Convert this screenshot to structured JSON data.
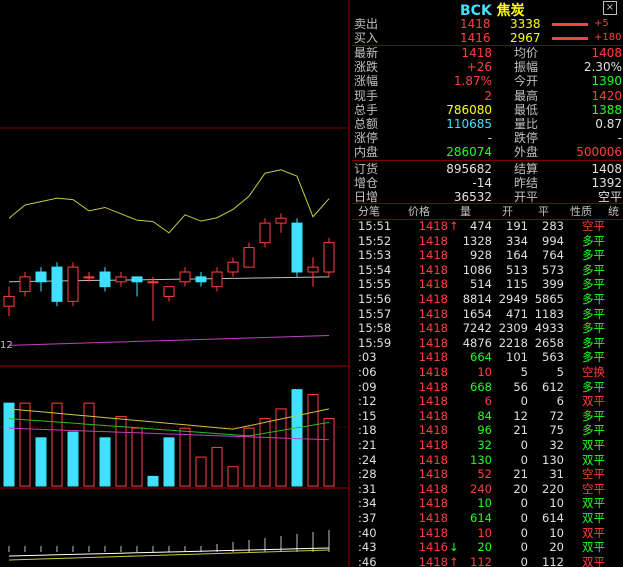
{
  "header": {
    "code": "BCK",
    "name": "焦炭",
    "close_glyph": "×"
  },
  "order_book": [
    {
      "label": "卖出",
      "price": "1418",
      "volume": "3338",
      "delta": "+5"
    },
    {
      "label": "买入",
      "price": "1416",
      "volume": "2967",
      "delta": "+180"
    }
  ],
  "quote": [
    {
      "l1": "最新",
      "v1": "1418",
      "c1": "red",
      "l2": "均价",
      "v2": "1408",
      "c2": "red"
    },
    {
      "l1": "涨跌",
      "v1": "+26",
      "c1": "red",
      "l2": "振幅",
      "v2": "2.30%",
      "c2": "white"
    },
    {
      "l1": "涨幅",
      "v1": "1.87%",
      "c1": "red",
      "l2": "今开",
      "v2": "1390",
      "c2": "green"
    },
    {
      "l1": "现手",
      "v1": "2",
      "c1": "red",
      "l2": "最高",
      "v2": "1420",
      "c2": "red"
    },
    {
      "l1": "总手",
      "v1": "786080",
      "c1": "yellow",
      "l2": "最低",
      "v2": "1388",
      "c2": "green"
    },
    {
      "l1": "总额",
      "v1": "110685",
      "c1": "cyan",
      "l2": "量比",
      "v2": "0.87",
      "c2": "white"
    },
    {
      "l1": "涨停",
      "v1": "-",
      "c1": "white",
      "l2": "跌停",
      "v2": "-",
      "c2": "white"
    },
    {
      "l1": "内盘",
      "v1": "286074",
      "c1": "green",
      "l2": "外盘",
      "v2": "500006",
      "c2": "red"
    }
  ],
  "stats": [
    {
      "l1": "订货",
      "v1": "895682",
      "l2": "结算",
      "v2": "1408"
    },
    {
      "l1": "增仓",
      "v1": "-14",
      "l2": "昨结",
      "v2": "1392"
    },
    {
      "l1": "日增",
      "v1": "36532",
      "l2": "开平",
      "v2": "空平"
    }
  ],
  "tick_headers": [
    "分笔",
    "价格",
    "量",
    "开",
    "平",
    "性质",
    "统"
  ],
  "ticks": [
    {
      "t": "15:51",
      "p": "1418",
      "a": "up",
      "v": "474",
      "o": "191",
      "c": "283",
      "n": "空平",
      "nc": "red"
    },
    {
      "t": "15:52",
      "p": "1418",
      "a": "",
      "v": "1328",
      "o": "334",
      "c": "994",
      "n": "多平",
      "nc": "green"
    },
    {
      "t": "15:53",
      "p": "1418",
      "a": "",
      "v": "928",
      "o": "164",
      "c": "764",
      "n": "多平",
      "nc": "green"
    },
    {
      "t": "15:54",
      "p": "1418",
      "a": "",
      "v": "1086",
      "o": "513",
      "c": "573",
      "n": "多平",
      "nc": "green"
    },
    {
      "t": "15:55",
      "p": "1418",
      "a": "",
      "v": "514",
      "o": "115",
      "c": "399",
      "n": "多平",
      "nc": "green"
    },
    {
      "t": "15:56",
      "p": "1418",
      "a": "",
      "v": "8814",
      "o": "2949",
      "c": "5865",
      "n": "多平",
      "nc": "green"
    },
    {
      "t": "15:57",
      "p": "1418",
      "a": "",
      "v": "1654",
      "o": "471",
      "c": "1183",
      "n": "多平",
      "nc": "green"
    },
    {
      "t": "15:58",
      "p": "1418",
      "a": "",
      "v": "7242",
      "o": "2309",
      "c": "4933",
      "n": "多平",
      "nc": "green"
    },
    {
      "t": "15:59",
      "p": "1418",
      "a": "",
      "v": "4876",
      "o": "2218",
      "c": "2658",
      "n": "多平",
      "nc": "green"
    },
    {
      "t": ":03",
      "p": "1418",
      "a": "",
      "v": "664",
      "o": "101",
      "c": "563",
      "n": "多平",
      "nc": "green"
    },
    {
      "t": ":06",
      "p": "1418",
      "a": "",
      "v": "10",
      "o": "5",
      "c": "5",
      "n": "空换",
      "nc": "red"
    },
    {
      "t": ":09",
      "p": "1418",
      "a": "",
      "v": "668",
      "o": "56",
      "c": "612",
      "n": "多平",
      "nc": "green"
    },
    {
      "t": ":12",
      "p": "1418",
      "a": "",
      "v": "6",
      "o": "0",
      "c": "6",
      "n": "双平",
      "nc": "red"
    },
    {
      "t": ":15",
      "p": "1418",
      "a": "",
      "v": "84",
      "o": "12",
      "c": "72",
      "n": "多平",
      "nc": "green"
    },
    {
      "t": ":18",
      "p": "1418",
      "a": "",
      "v": "96",
      "o": "21",
      "c": "75",
      "n": "多平",
      "nc": "green"
    },
    {
      "t": ":21",
      "p": "1418",
      "a": "",
      "v": "32",
      "o": "0",
      "c": "32",
      "n": "双平",
      "nc": "green"
    },
    {
      "t": ":24",
      "p": "1418",
      "a": "",
      "v": "130",
      "o": "0",
      "c": "130",
      "n": "双平",
      "nc": "green"
    },
    {
      "t": ":28",
      "p": "1418",
      "a": "",
      "v": "52",
      "o": "21",
      "c": "31",
      "n": "空平",
      "nc": "red"
    },
    {
      "t": ":31",
      "p": "1418",
      "a": "",
      "v": "240",
      "o": "20",
      "c": "220",
      "n": "空平",
      "nc": "red"
    },
    {
      "t": ":34",
      "p": "1418",
      "a": "",
      "v": "10",
      "o": "0",
      "c": "10",
      "n": "双平",
      "nc": "green"
    },
    {
      "t": ":37",
      "p": "1418",
      "a": "",
      "v": "614",
      "o": "0",
      "c": "614",
      "n": "双平",
      "nc": "green"
    },
    {
      "t": ":40",
      "p": "1418",
      "a": "",
      "v": "10",
      "o": "0",
      "c": "10",
      "n": "双平",
      "nc": "red"
    },
    {
      "t": ":43",
      "p": "1416",
      "a": "down",
      "v": "20",
      "o": "0",
      "c": "20",
      "n": "双平",
      "nc": "green"
    },
    {
      "t": ":46",
      "p": "1418",
      "a": "up",
      "v": "112",
      "o": "0",
      "c": "112",
      "n": "双平",
      "nc": "red"
    }
  ],
  "chart": {
    "left_label": "12"
  },
  "chart_data": {
    "type": "bar",
    "candles": [
      {
        "o": 1396,
        "c": 1398,
        "h": 1400,
        "l": 1394
      },
      {
        "o": 1399,
        "c": 1402,
        "h": 1403,
        "l": 1398
      },
      {
        "o": 1403,
        "c": 1401,
        "h": 1404,
        "l": 1399
      },
      {
        "o": 1404,
        "c": 1397,
        "h": 1405,
        "l": 1396
      },
      {
        "o": 1397,
        "c": 1404,
        "h": 1405,
        "l": 1396
      },
      {
        "o": 1402,
        "c": 1402,
        "h": 1403,
        "l": 1401
      },
      {
        "o": 1403,
        "c": 1400,
        "h": 1404,
        "l": 1399
      },
      {
        "o": 1401,
        "c": 1402,
        "h": 1403,
        "l": 1400
      },
      {
        "o": 1402,
        "c": 1401,
        "h": 1402,
        "l": 1398
      },
      {
        "o": 1401,
        "c": 1401,
        "h": 1402,
        "l": 1393
      },
      {
        "o": 1398,
        "c": 1400,
        "h": 1400,
        "l": 1397
      },
      {
        "o": 1401,
        "c": 1403,
        "h": 1404,
        "l": 1400
      },
      {
        "o": 1402,
        "c": 1401,
        "h": 1403,
        "l": 1400
      },
      {
        "o": 1400,
        "c": 1403,
        "h": 1404,
        "l": 1399
      },
      {
        "o": 1403,
        "c": 1405,
        "h": 1406,
        "l": 1402
      },
      {
        "o": 1404,
        "c": 1408,
        "h": 1409,
        "l": 1404
      },
      {
        "o": 1409,
        "c": 1413,
        "h": 1414,
        "l": 1408
      },
      {
        "o": 1413,
        "c": 1414,
        "h": 1415,
        "l": 1411
      },
      {
        "o": 1413,
        "c": 1403,
        "h": 1414,
        "l": 1402
      },
      {
        "o": 1403,
        "c": 1404,
        "h": 1406,
        "l": 1400
      },
      {
        "o": 1403,
        "c": 1409,
        "h": 1410,
        "l": 1402
      }
    ],
    "volumes": [
      86,
      86,
      50,
      86,
      56,
      86,
      50,
      72,
      60,
      10,
      50,
      60,
      30,
      40,
      20,
      60,
      70,
      80,
      100,
      95,
      70
    ],
    "volume_colors": [
      "cyan",
      "red",
      "cyan",
      "red",
      "cyan",
      "red",
      "cyan",
      "red",
      "red",
      "cyan",
      "cyan",
      "red",
      "red",
      "red",
      "red",
      "red",
      "red",
      "red",
      "cyan",
      "red",
      "red"
    ],
    "price_range": [
      1385,
      1430
    ],
    "volume_range": [
      0,
      110
    ]
  }
}
